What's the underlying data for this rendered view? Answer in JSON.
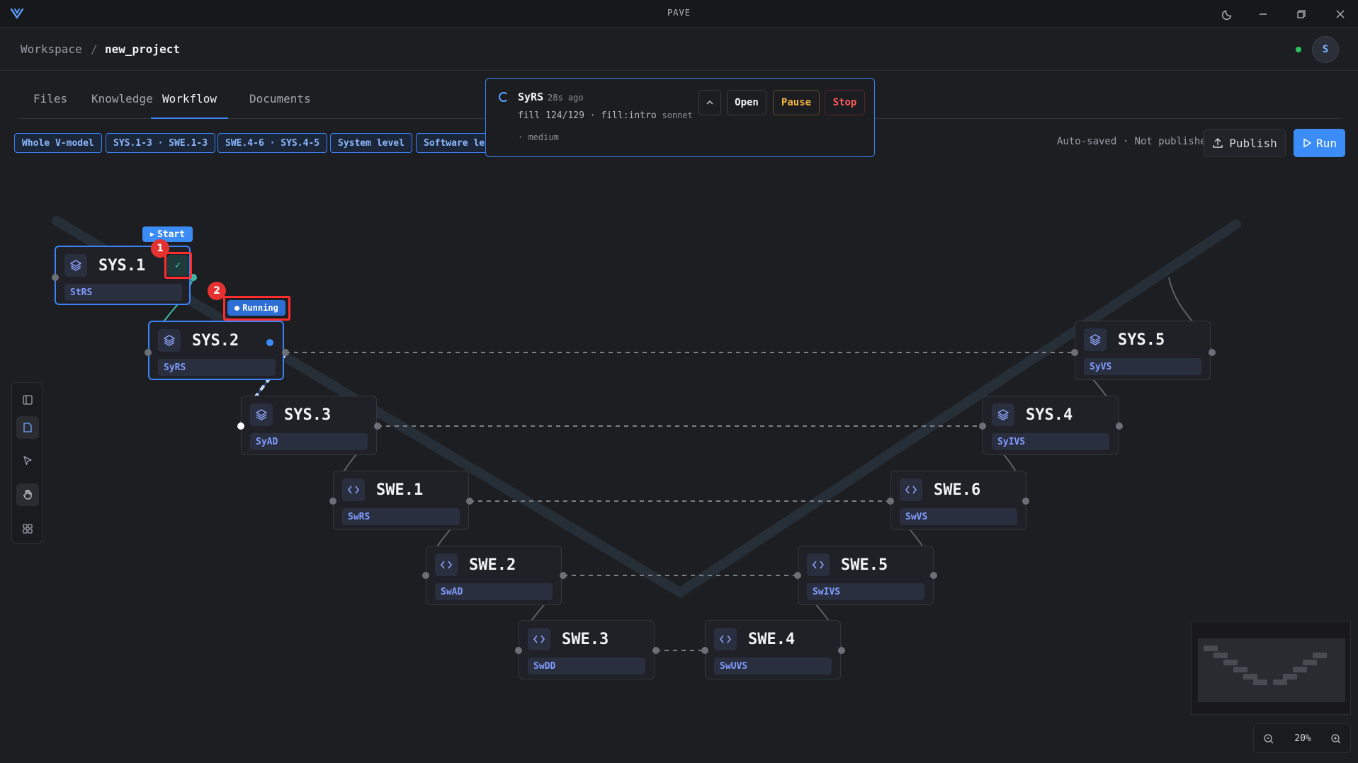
{
  "app": {
    "title": "PAVE"
  },
  "breadcrumb": {
    "workspace": "Workspace",
    "separator": "/",
    "project": "new_project"
  },
  "user": {
    "avatar_letter": "S",
    "status_color": "#2fc25b"
  },
  "tabs": [
    {
      "label": "Files"
    },
    {
      "label": "Knowledge"
    },
    {
      "label": "Workflow"
    },
    {
      "label": "Documents"
    }
  ],
  "active_tab": "Workflow",
  "filters": [
    {
      "label": "Whole V-model"
    },
    {
      "label": "SYS.1-3 · SWE.1-3"
    },
    {
      "label": "SWE.4-6 · SYS.4-5"
    },
    {
      "label": "System level"
    },
    {
      "label": "Software lev"
    }
  ],
  "toolbar": {
    "autosave_text": "Auto-saved · Not published",
    "publish_label": "Publish",
    "run_label": "Run"
  },
  "task_popup": {
    "title": "SyRS",
    "time_ago": "28s ago",
    "progress_text": "fill 124/129 · fill:intro",
    "model": "sonnet",
    "effort": "· medium",
    "open_label": "Open",
    "pause_label": "Pause",
    "stop_label": "Stop"
  },
  "badges": {
    "start_label": "Start",
    "running_label": "Running",
    "marker_1": "1",
    "marker_2": "2"
  },
  "nodes": {
    "sys1": {
      "title": "SYS.1",
      "subtitle": "StRS",
      "icon": "layers-icon"
    },
    "sys2": {
      "title": "SYS.2",
      "subtitle": "SyRS",
      "icon": "layers-icon"
    },
    "sys3": {
      "title": "SYS.3",
      "subtitle": "SyAD",
      "icon": "layers-icon"
    },
    "swe1": {
      "title": "SWE.1",
      "subtitle": "SwRS",
      "icon": "code-icon"
    },
    "swe2": {
      "title": "SWE.2",
      "subtitle": "SwAD",
      "icon": "code-icon"
    },
    "swe3": {
      "title": "SWE.3",
      "subtitle": "SwDD",
      "icon": "code-icon"
    },
    "swe4": {
      "title": "SWE.4",
      "subtitle": "SwUVS",
      "icon": "code-icon"
    },
    "swe5": {
      "title": "SWE.5",
      "subtitle": "SwIVS",
      "icon": "code-icon"
    },
    "swe6": {
      "title": "SWE.6",
      "subtitle": "SwVS",
      "icon": "code-icon"
    },
    "sys4": {
      "title": "SYS.4",
      "subtitle": "SyIVS",
      "icon": "layers-icon"
    },
    "sys5": {
      "title": "SYS.5",
      "subtitle": "SyVS",
      "icon": "layers-icon"
    }
  },
  "zoom": {
    "level": "20%"
  },
  "colors": {
    "accent": "#3b82f6",
    "pause": "#f2b33d",
    "stop": "#ff5a5f",
    "annotation": "#ff2d2d"
  }
}
